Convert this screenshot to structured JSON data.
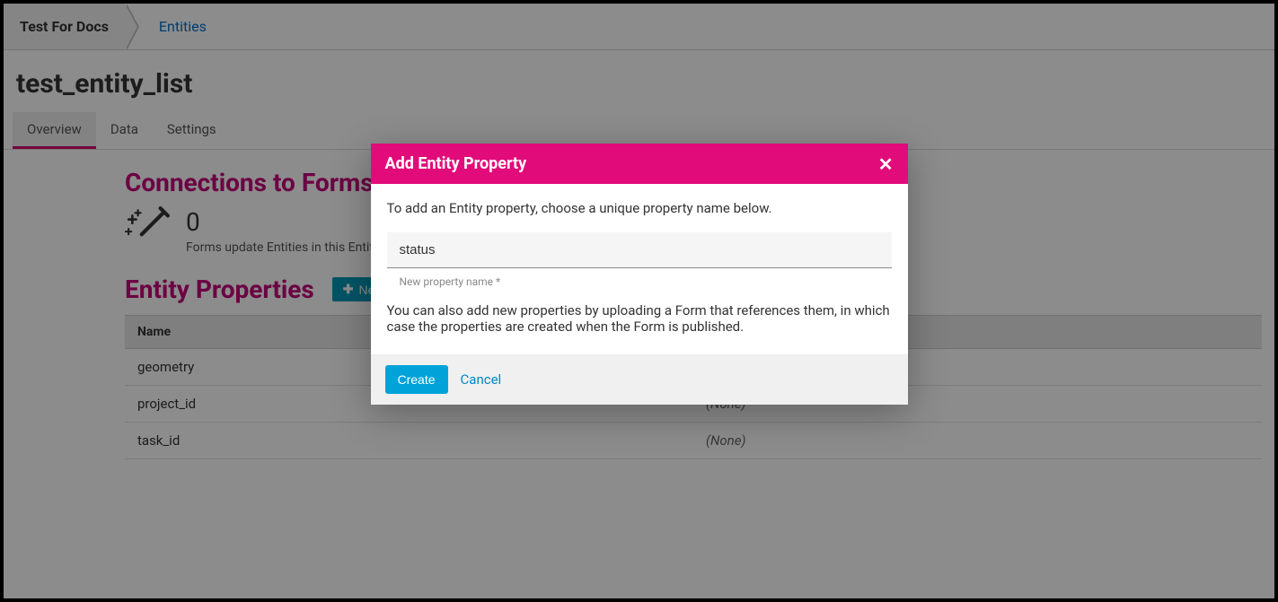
{
  "breadcrumb": {
    "root": "Test For Docs",
    "entities": "Entities"
  },
  "page_title": "test_entity_list",
  "tabs": {
    "overview": "Overview",
    "data": "Data",
    "settings": "Settings"
  },
  "connections": {
    "heading": "Connections to Forms",
    "count": "0",
    "subtext": "Forms update Entities in this Entity List"
  },
  "entity_properties": {
    "heading": "Entity Properties",
    "new_button": "New",
    "columns": {
      "name": "Name"
    },
    "none_label": "(None)",
    "rows": [
      {
        "name": "geometry",
        "forms": ""
      },
      {
        "name": "project_id",
        "forms": "(None)"
      },
      {
        "name": "task_id",
        "forms": "(None)"
      }
    ]
  },
  "modal": {
    "title": "Add Entity Property",
    "intro": "To add an Entity property, choose a unique property name below.",
    "input_value": "status",
    "input_label": "New property name *",
    "secondary": "You can also add new properties by uploading a Form that references them, in which case the properties are created when the Form is published.",
    "create": "Create",
    "cancel": "Cancel"
  }
}
